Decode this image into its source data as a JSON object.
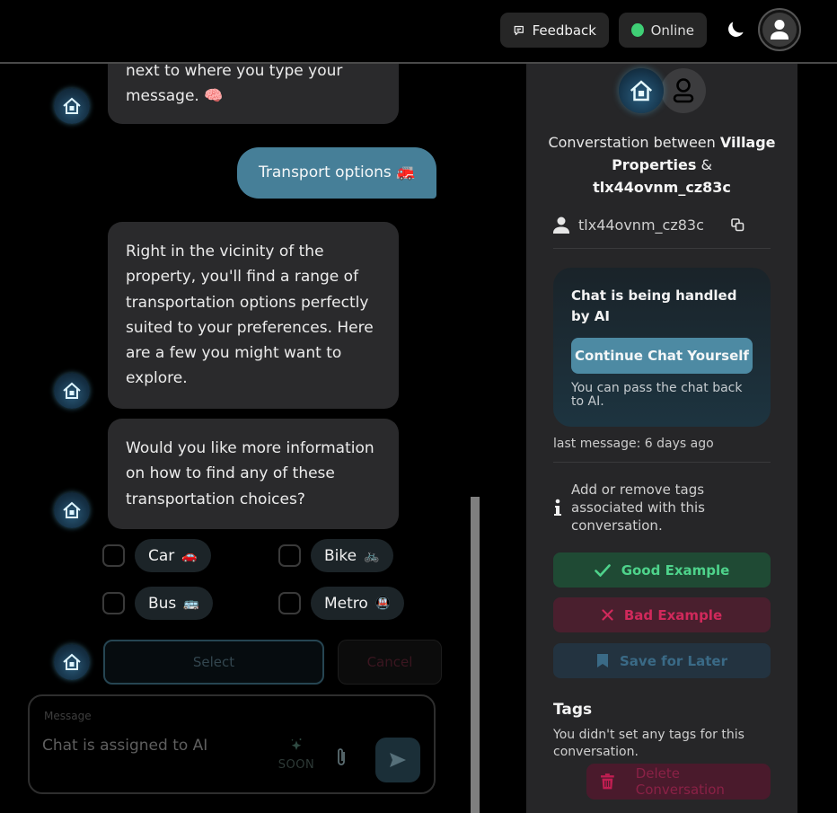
{
  "topbar": {
    "feedback_label": "Feedback",
    "status_label": "Online",
    "status_color": "#3fcf75",
    "icons": {
      "feedback": "message-square-icon",
      "theme": "moon-icon",
      "profile": "user-icon"
    }
  },
  "chat": {
    "messages": [
      {
        "sender": "bot",
        "text_line1": "next to where you type your",
        "text_line2": "message. 🧠"
      },
      {
        "sender": "user",
        "text": "Transport options 🚒"
      },
      {
        "sender": "bot",
        "text": "Right in the vicinity of the property, you'll find a range of transportation options perfectly suited to your preferences. Here are a few you might want to explore."
      },
      {
        "sender": "bot",
        "text": "Would you like more information on how to find any of these transportation choices?"
      }
    ],
    "options": [
      {
        "label": "Car",
        "emoji": "🚗",
        "checked": false
      },
      {
        "label": "Bike",
        "emoji": "🚲",
        "checked": false
      },
      {
        "label": "Bus",
        "emoji": "🚌",
        "checked": false
      },
      {
        "label": "Metro",
        "emoji": "🚇",
        "checked": false
      }
    ],
    "select_label": "Select",
    "cancel_label": "Cancel",
    "composer": {
      "label": "Message",
      "placeholder": "Chat is assigned to AI",
      "soon_label": "SOON",
      "icons": {
        "ai": "sparkle-icon",
        "attach": "paperclip-icon",
        "send": "send-icon"
      }
    },
    "colors": {
      "user_bubble": "#467f98",
      "bot_bubble": "#2a2a2c"
    }
  },
  "panel": {
    "title_prefix": "Converstation between ",
    "business_name": "Village Properties",
    "title_joiner": " & ",
    "visitor_id": "tlx44ovnm_cz83c",
    "ai_card": {
      "title": "Chat is being handled by AI",
      "button_label": "Continue Chat Yourself",
      "note": "You can pass the chat back to AI."
    },
    "last_message": "last message: 6 days ago",
    "tags_info": "Add or remove tags associated with this conversation.",
    "good_label": "Good Example",
    "bad_label": "Bad Example",
    "save_label": "Save for Later",
    "tags_heading": "Tags",
    "tags_empty": "You didn't set any tags for this conversation.",
    "delete_label": "Delete Conversation",
    "colors": {
      "good": "#4ed38b",
      "bad": "#d0295b",
      "save": "#3a6a86",
      "accent": "#4d8aa3"
    }
  }
}
